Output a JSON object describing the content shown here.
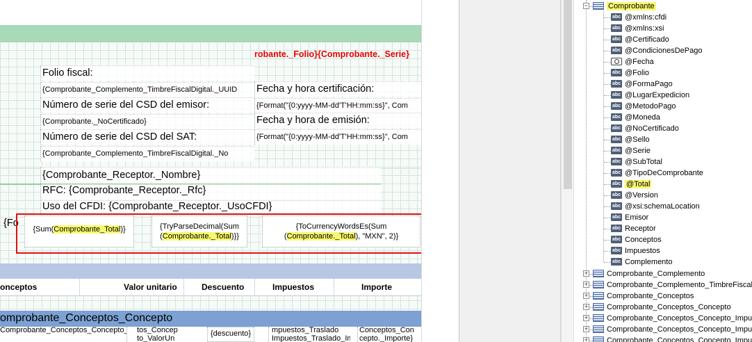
{
  "designer": {
    "folio_serie": "robante._Folio}{Comprobante._Serie}",
    "labels": {
      "folio_fiscal": "Folio fiscal:",
      "folio_fiscal_expr": "{Comprobante_Complemento_TimbreFiscalDigital._UUID",
      "fecha_cert": "Fecha y hora certificación:",
      "fecha_cert_expr": "{Format(\"{0:yyyy-MM-dd'T'HH:mm:ss}\", Com",
      "serie_csd_emisor": "Número de serie del CSD del emisor:",
      "serie_csd_emisor_expr": "{Comprobante._NoCertificado}",
      "fecha_emision": "Fecha y hora de emisión:",
      "fecha_emision_expr": "{Format(\"{0:yyyy-MM-dd'T'HH:mm:ss}\", Com",
      "serie_csd_sat": "Número de serie del CSD del SAT:",
      "serie_csd_sat_expr": "{Comprobante_Complemento_TimbreFiscalDigital._No",
      "receptor_nombre": "{Comprobante_Receptor._Nombre}",
      "receptor_rfc": "RFC: {Comprobante_Receptor._Rfc}",
      "uso_cfdi": "Uso del CFDI: {Comprobante_Receptor._UsoCFDI}",
      "left_cut": "{Fo"
    },
    "total_cells": {
      "sum": {
        "before": "{Sum(",
        "highlight": "Comprobante_Total",
        "after": ")}"
      },
      "tryparse": {
        "line1": "{TryParseDecimal(Sum",
        "before": "(",
        "highlight": "Comprobante._Total",
        "after": ")}}"
      },
      "currency": {
        "line1": "{ToCurrencyWordsEs(Sum",
        "before": "(",
        "highlight": "Comprobante._Total",
        "after": "), \"MXN\", 2)}"
      }
    },
    "headers": [
      "onceptos",
      "Valor unitario",
      "Descuento",
      "Impuestos",
      "Importe"
    ],
    "band_title": "omprobante_Conceptos_Concepto",
    "detail": {
      "c1": "Comprobante_Conceptos_Concepto_Desc",
      "c2a": "tos_Concep",
      "c2b": "to_ValorUn",
      "c3": "{descuento}",
      "c4a": "mpuestos_Traslado",
      "c4b": "Impuestos_Traslado_Importe",
      "c5a": "Conceptos_Con",
      "c5b": "cepto._Importe}"
    }
  },
  "tree": {
    "root": "Comprobante",
    "fields": [
      {
        "label": "@xmlns:cfdi",
        "icon": "abc-icon"
      },
      {
        "label": "@xmlns:xsi",
        "icon": "abc-icon"
      },
      {
        "label": "@Certificado",
        "icon": "abc-icon"
      },
      {
        "label": "@CondicionesDePago",
        "icon": "abc-icon"
      },
      {
        "label": "@Fecha",
        "icon": "clock-icon"
      },
      {
        "label": "@Folio",
        "icon": "abc-icon"
      },
      {
        "label": "@FormaPago",
        "icon": "abc-icon"
      },
      {
        "label": "@LugarExpedicion",
        "icon": "abc-icon"
      },
      {
        "label": "@MetodoPago",
        "icon": "abc-icon"
      },
      {
        "label": "@Moneda",
        "icon": "abc-icon"
      },
      {
        "label": "@NoCertificado",
        "icon": "abc-icon"
      },
      {
        "label": "@Sello",
        "icon": "abc-icon"
      },
      {
        "label": "@Serie",
        "icon": "abc-icon"
      },
      {
        "label": "@SubTotal",
        "icon": "abc-icon"
      },
      {
        "label": "@TipoDeComprobante",
        "icon": "abc-icon"
      },
      {
        "label": "@Total",
        "icon": "abc-icon",
        "highlight": true
      },
      {
        "label": "@Version",
        "icon": "abc-icon"
      },
      {
        "label": "@xsi:schemaLocation",
        "icon": "abc-icon"
      },
      {
        "label": "Emisor",
        "icon": "abc-icon"
      },
      {
        "label": "Receptor",
        "icon": "abc-icon"
      },
      {
        "label": "Conceptos",
        "icon": "abc-icon"
      },
      {
        "label": "Impuestos",
        "icon": "abc-icon"
      },
      {
        "label": "Complemento",
        "icon": "abc-icon"
      }
    ],
    "tables": [
      "Comprobante_Complemento",
      "Comprobante_Complemento_TimbreFiscalDigital",
      "Comprobante_Conceptos",
      "Comprobante_Conceptos_Concepto",
      "Comprobante_Conceptos_Concepto_Impuestos",
      "Comprobante_Conceptos_Concepto_Impuestos_Traslados",
      "Comprobante_Conceptos_Concepto_Impuestos_Traslados_Traslado"
    ]
  },
  "colors": {
    "highlight": "#f8f870",
    "selection_box": "#e01010",
    "band_green": "#a8d9b9",
    "band_blue": "#7ca1d2"
  }
}
